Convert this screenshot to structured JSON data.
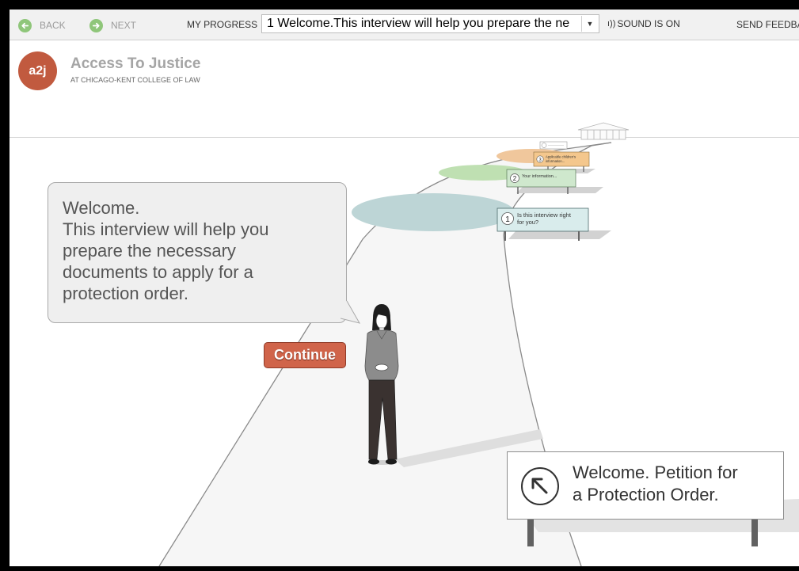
{
  "toolbar": {
    "back_label": "BACK",
    "next_label": "NEXT",
    "progress_label": "MY PROGRESS",
    "progress_selected": "1 Welcome.This interview will help you prepare the ne",
    "sound_label": "SOUND IS ON",
    "feedback_label": "SEND FEEDBA"
  },
  "header": {
    "logo_text": "a2j",
    "title": "Access To Justice",
    "subtitle": "AT CHICAGO-KENT COLLEGE OF LAW"
  },
  "bubble": {
    "lines": [
      "Welcome.",
      "This interview will help you",
      "prepare the necessary",
      "documents to apply for a",
      "protection order."
    ]
  },
  "continue_label": "Continue",
  "road_signs": [
    {
      "number": "1",
      "text_line1": "Is this interview right",
      "text_line2": "for you?"
    },
    {
      "number": "2",
      "text_line1": "Your information...",
      "text_line2": ""
    },
    {
      "number": "3",
      "text_line1": "Applicable children's",
      "text_line2": "information..."
    }
  ],
  "bottom_sign": {
    "line1": "Welcome. Petition for",
    "line2": "a Protection Order."
  },
  "icons": {
    "back": "arrow-left-circle",
    "next": "arrow-right-circle",
    "sound": "speaker-waves",
    "dropdown": "chevron-down",
    "sign": "arrow-up-left-circle"
  },
  "colors": {
    "logo": "#c15a3f",
    "nav_circle": "#8fc67a",
    "button": "#d0644a",
    "sign1_disc": "#bdd5d6",
    "sign2_disc": "#bfe0b2",
    "sign3_disc": "#f0c79c"
  }
}
